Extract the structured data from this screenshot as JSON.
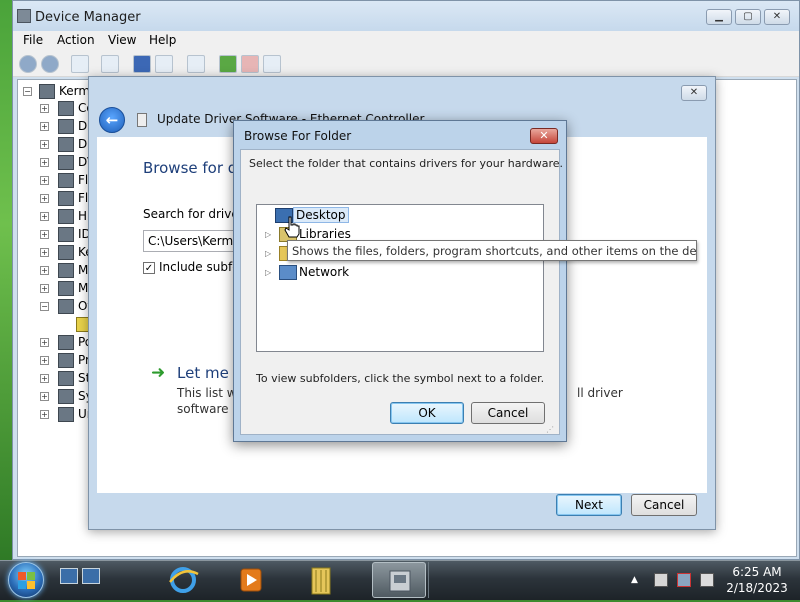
{
  "device_manager": {
    "title": "Device Manager",
    "menu": [
      "File",
      "Action",
      "View",
      "Help"
    ],
    "tree_root": "Kermi",
    "tree_items": [
      "Co",
      "Di",
      "Di",
      "DV",
      "Fl",
      "Fl",
      "Hu",
      "ID",
      "Ke",
      "Mi",
      "Mo",
      "Ot",
      "",
      "Po",
      "Pr",
      "St",
      "Sy",
      "Un"
    ]
  },
  "wizard": {
    "title": "Update Driver Software - Ethernet Controller",
    "heading": "Browse for dri",
    "search_label": "Search for driver so",
    "path_value": "C:\\Users\\Kermie\\",
    "include_subfolders_label": "Include subfold",
    "include_subfolders_checked": true,
    "option_title": "Let me pi",
    "option_desc_1": "This list will s",
    "option_desc_2": "software in t",
    "option_desc_tail": "ll driver",
    "next_label": "Next",
    "cancel_label": "Cancel"
  },
  "browse_dialog": {
    "title": "Browse For Folder",
    "close_glyph": "✕",
    "instruction": "Select the folder that contains drivers for your hardware.",
    "nodes": [
      {
        "label": "Desktop",
        "selected": true
      },
      {
        "label": "Libraries",
        "selected": false
      },
      {
        "label": "",
        "selected": false
      },
      {
        "label": "Network",
        "selected": false
      }
    ],
    "tooltip": "Shows the files, folders, program shortcuts, and other items on the desktop.",
    "hint": "To view subfolders, click the symbol next to a folder.",
    "ok_label": "OK",
    "cancel_label": "Cancel"
  },
  "taskbar": {
    "time": "6:25 AM",
    "date": "2/18/2023"
  },
  "colors": {
    "accent_blue": "#1e3f7a",
    "close_red": "#c5463a",
    "selection": "#dbeaf9"
  }
}
